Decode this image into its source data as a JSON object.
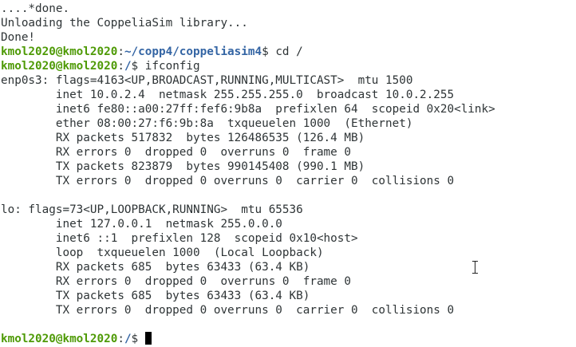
{
  "output_top": [
    "....*done.",
    "Unloading the CoppeliaSim library...",
    "Done!"
  ],
  "prompt1": {
    "user": "kmol2020@kmol2020",
    "sep": ":",
    "path": "~/copp4/coppeliasim4",
    "sym": "$ ",
    "cmd": "cd /"
  },
  "prompt2": {
    "user": "kmol2020@kmol2020",
    "sep": ":",
    "path": "/",
    "sym": "$ ",
    "cmd": "ifconfig"
  },
  "ifconfig_output": [
    "enp0s3: flags=4163<UP,BROADCAST,RUNNING,MULTICAST>  mtu 1500",
    "        inet 10.0.2.4  netmask 255.255.255.0  broadcast 10.0.2.255",
    "        inet6 fe80::a00:27ff:fef6:9b8a  prefixlen 64  scopeid 0x20<link>",
    "        ether 08:00:27:f6:9b:8a  txqueuelen 1000  (Ethernet)",
    "        RX packets 517832  bytes 126486535 (126.4 MB)",
    "        RX errors 0  dropped 0  overruns 0  frame 0",
    "        TX packets 823879  bytes 990145408 (990.1 MB)",
    "        TX errors 0  dropped 0 overruns 0  carrier 0  collisions 0",
    "",
    "lo: flags=73<UP,LOOPBACK,RUNNING>  mtu 65536",
    "        inet 127.0.0.1  netmask 255.0.0.0",
    "        inet6 ::1  prefixlen 128  scopeid 0x10<host>",
    "        loop  txqueuelen 1000  (Local Loopback)",
    "        RX packets 685  bytes 63433 (63.4 KB)",
    "        RX errors 0  dropped 0  overruns 0  frame 0",
    "        TX packets 685  bytes 63433 (63.4 KB)",
    "        TX errors 0  dropped 0 overruns 0  carrier 0  collisions 0",
    ""
  ],
  "prompt3": {
    "user": "kmol2020@kmol2020",
    "sep": ":",
    "path": "/",
    "sym": "$ "
  },
  "colors": {
    "background": "#ffffff",
    "text": "#2e3436",
    "prompt_user": "#4e9a06",
    "prompt_path": "#3465a4",
    "cursor": "#000000"
  },
  "icons": {
    "mouse_pointer": "text-cursor-ibeam-icon",
    "terminal_cursor": "block-cursor-icon"
  }
}
